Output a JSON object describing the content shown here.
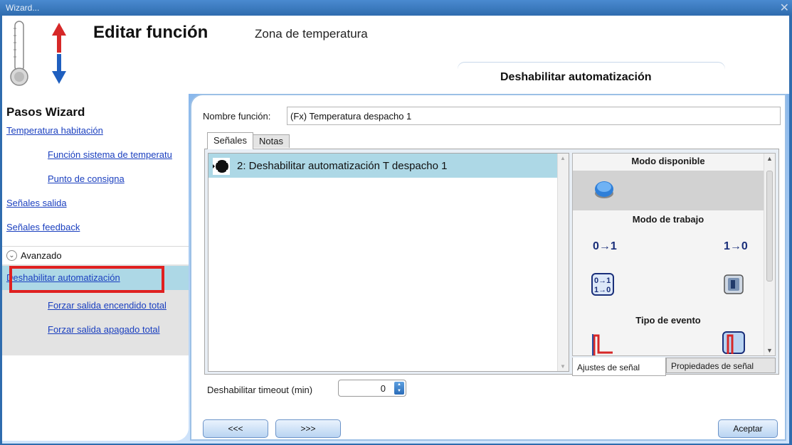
{
  "window": {
    "title": "Wizard...",
    "close": "✕"
  },
  "header": {
    "title": "Editar función",
    "subtitle": "Zona de temperatura",
    "tab_title": "Deshabilitar automatización"
  },
  "sidebar": {
    "heading": "Pasos Wizard",
    "items": [
      {
        "label": "Temperatura habitación"
      },
      {
        "label": "Función sistema de temperatu"
      },
      {
        "label": "Punto de consigna"
      },
      {
        "label": "Señales salida"
      },
      {
        "label": "Señales feedback"
      },
      {
        "label": "Deshabilitar automatización"
      },
      {
        "label": "Forzar salida encendido total"
      },
      {
        "label": "Forzar salida apagado total"
      }
    ],
    "advanced_label": "Avanzado",
    "selected_index": 5
  },
  "main": {
    "function_name_label": "Nombre función:",
    "function_name_value": "(Fx) Temperatura despacho 1",
    "tabs": [
      {
        "label": "Señales"
      },
      {
        "label": "Notas"
      }
    ],
    "signals": [
      {
        "label": "2: Deshabilitar automatización T despacho 1"
      }
    ],
    "properties": {
      "section_available": "Modo disponible",
      "section_work": "Modo de trabajo",
      "section_event": "Tipo de evento",
      "work_mode_01": "0→1",
      "work_mode_10": "1→0"
    },
    "bottom_tabs": [
      {
        "label": "Ajustes de señal"
      },
      {
        "label": "Propiedades de señal"
      }
    ],
    "timeout_label": "Deshabilitar timeout (min)",
    "timeout_value": "0"
  },
  "footer": {
    "prev_label": "<<<",
    "next_label": ">>>",
    "accept_label": "Aceptar"
  },
  "colors": {
    "accent": "#2f6cae",
    "selection": "#add8e6",
    "highlight": "#e02020",
    "link": "#1a3fbf"
  }
}
